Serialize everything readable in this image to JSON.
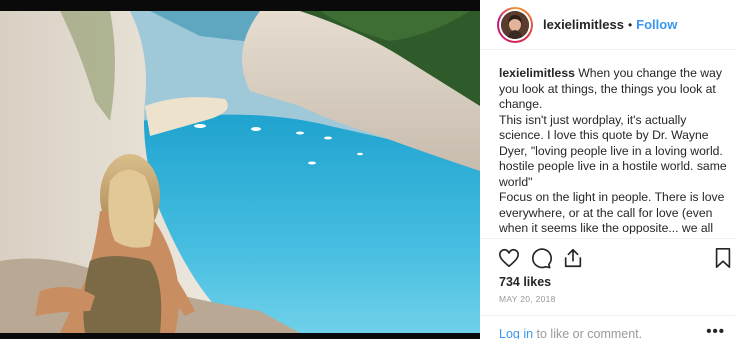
{
  "post": {
    "username": "lexielimitless",
    "follow_label": "Follow",
    "header_separator": "•",
    "caption": {
      "username": "lexielimitless",
      "lines": [
        "When you change the way you look at things, the things you look at change.",
        "This isn't just wordplay, it's actually science. I love this quote by Dr. Wayne Dyer, \"loving people live in a loving world. hostile people live in a hostile world. same world\"",
        "Focus on the light in people. There is love everywhere, or at the call for love (even when it seems like the opposite... we all want love). The world adjusts to our"
      ]
    },
    "likes": "734 likes",
    "date": "MAY 20, 2018",
    "comment": {
      "login_label": "Log in",
      "rest": " to like or comment.",
      "more_label": "•••"
    }
  },
  "icons": [
    "heart-icon",
    "comment-icon",
    "share-icon",
    "bookmark-icon",
    "more-options-icon"
  ],
  "colors": {
    "link_blue": "#3897f0",
    "text": "#262626",
    "muted": "#999999",
    "sea": "#3fb6dc"
  }
}
